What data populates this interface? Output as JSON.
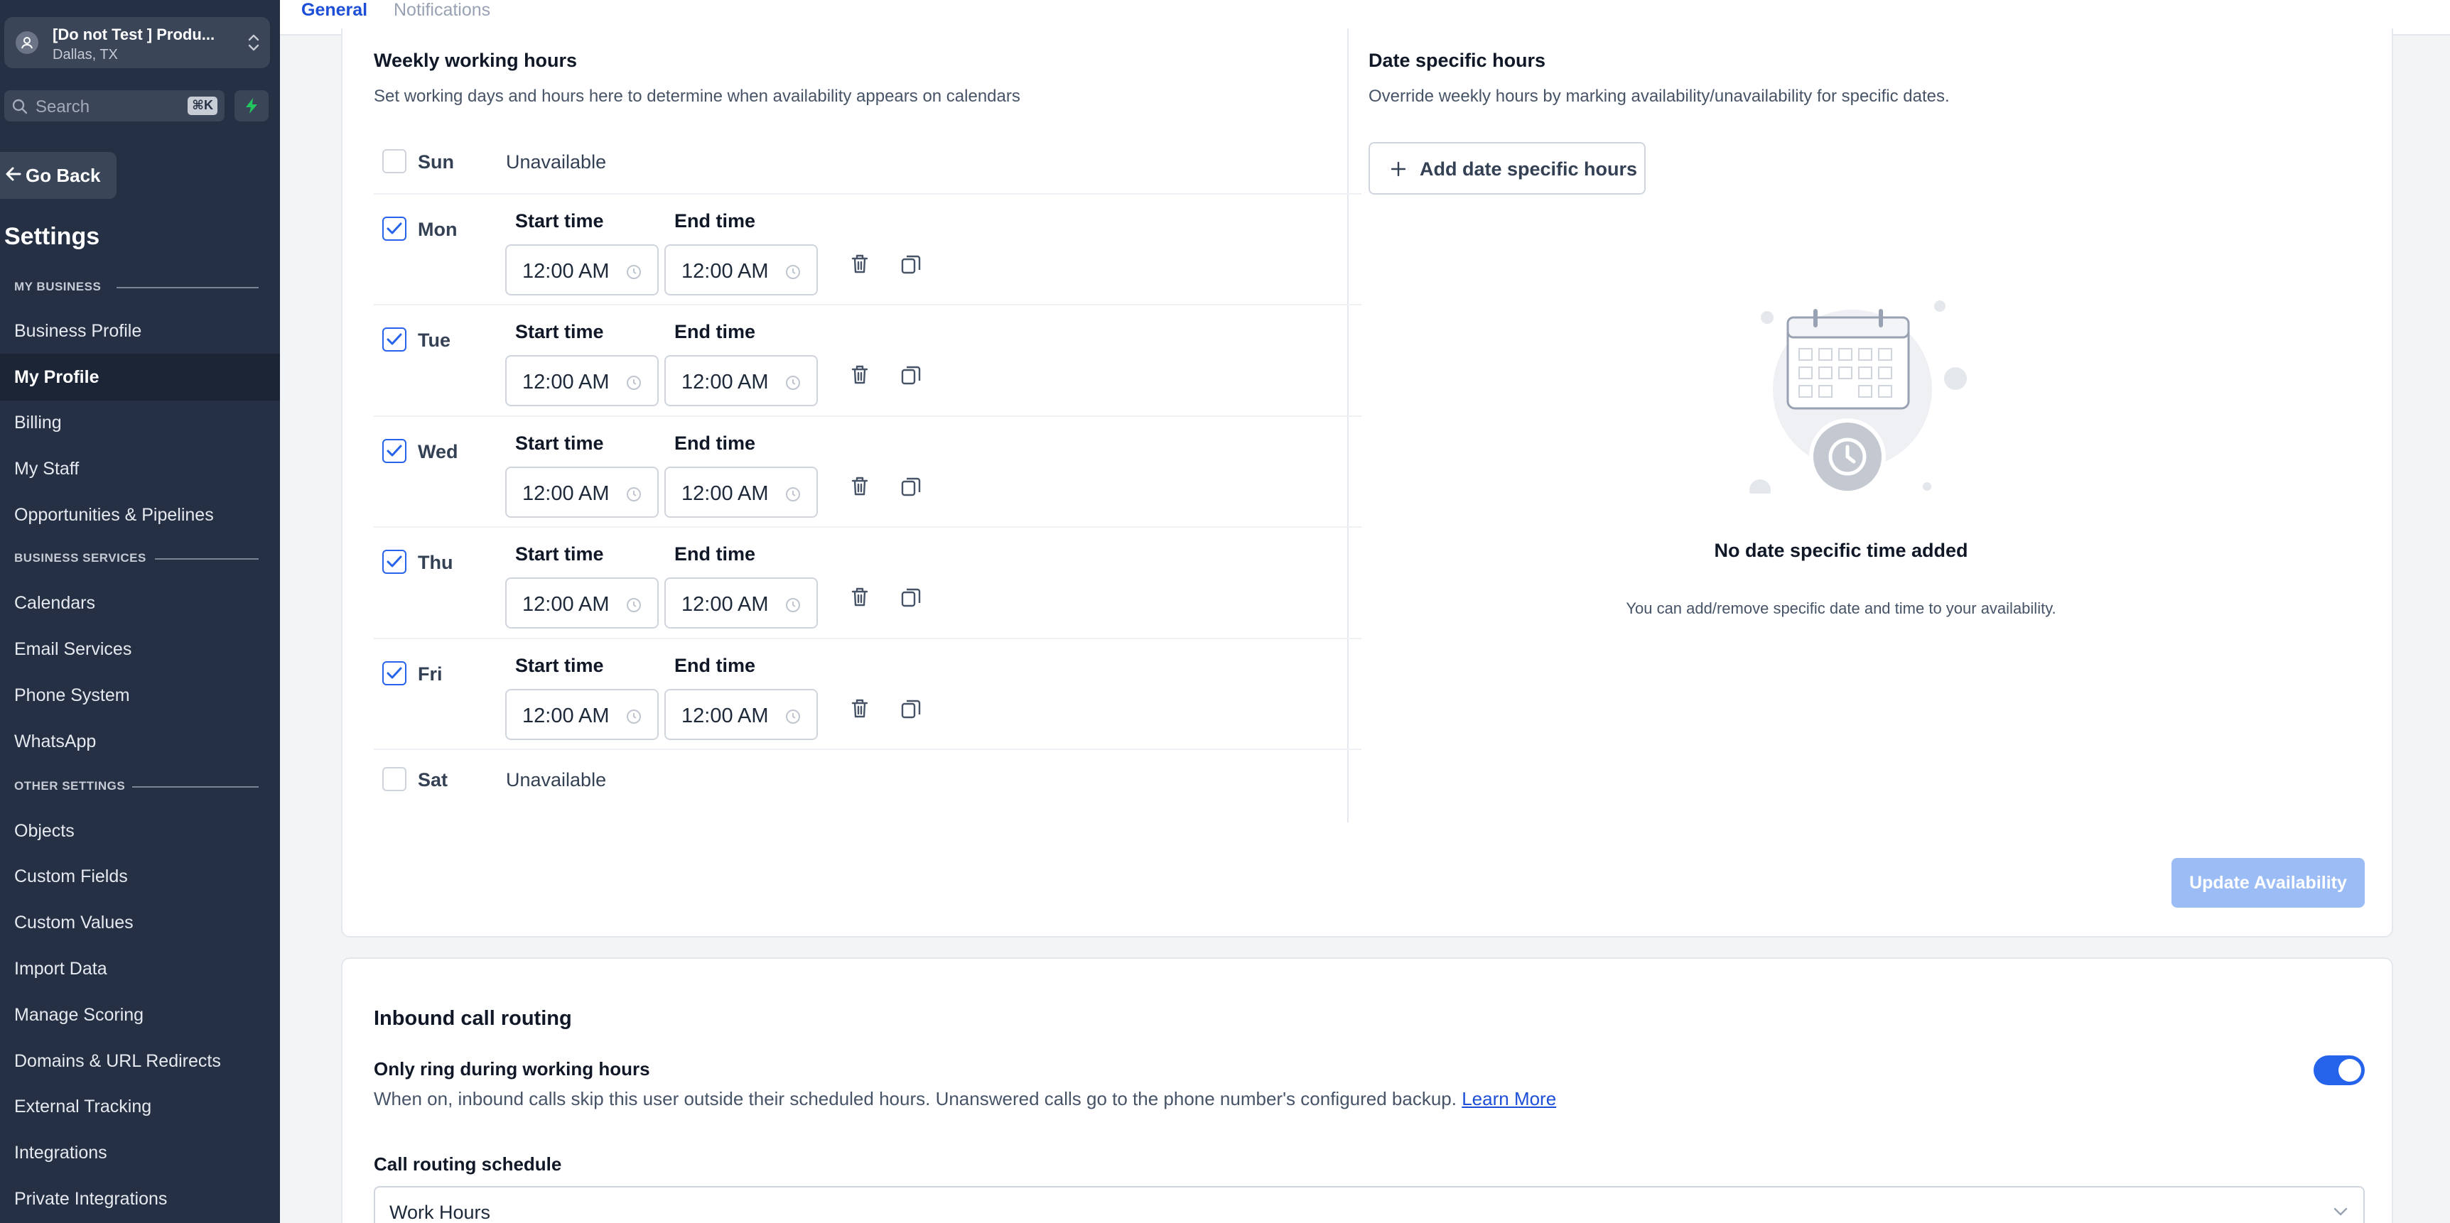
{
  "sidebar": {
    "account": {
      "name": "[Do not Test ] Produ...",
      "location": "Dallas, TX"
    },
    "search": {
      "placeholder": "Search",
      "shortcut": "⌘K"
    },
    "go_back": "Go Back",
    "title": "Settings",
    "sections": [
      {
        "heading": "MY BUSINESS",
        "items": [
          "Business Profile",
          "My Profile",
          "Billing",
          "My Staff",
          "Opportunities & Pipelines"
        ]
      },
      {
        "heading": "BUSINESS SERVICES",
        "items": [
          "Calendars",
          "Email Services",
          "Phone System",
          "WhatsApp"
        ]
      },
      {
        "heading": "OTHER SETTINGS",
        "items": [
          "Objects",
          "Custom Fields",
          "Custom Values",
          "Import Data",
          "Manage Scoring",
          "Domains & URL Redirects",
          "External Tracking",
          "Integrations",
          "Private Integrations"
        ]
      }
    ],
    "active_item": "My Profile"
  },
  "tabs": {
    "general": "General",
    "notifications": "Notifications",
    "active": "General"
  },
  "weekly": {
    "title": "Weekly working hours",
    "subtitle": "Set working days and hours here to determine when availability appears on calendars",
    "start_label": "Start time",
    "end_label": "End time",
    "unavailable_label": "Unavailable",
    "days": [
      {
        "name": "Sun",
        "enabled": false
      },
      {
        "name": "Mon",
        "enabled": true,
        "start": "12:00 AM",
        "end": "12:00 AM"
      },
      {
        "name": "Tue",
        "enabled": true,
        "start": "12:00 AM",
        "end": "12:00 AM"
      },
      {
        "name": "Wed",
        "enabled": true,
        "start": "12:00 AM",
        "end": "12:00 AM"
      },
      {
        "name": "Thu",
        "enabled": true,
        "start": "12:00 AM",
        "end": "12:00 AM"
      },
      {
        "name": "Fri",
        "enabled": true,
        "start": "12:00 AM",
        "end": "12:00 AM"
      },
      {
        "name": "Sat",
        "enabled": false
      }
    ]
  },
  "date_specific": {
    "title": "Date specific hours",
    "subtitle": "Override weekly hours by marking availability/unavailability for specific dates.",
    "add_button": "Add date specific hours",
    "empty_title": "No date specific time added",
    "empty_subtitle": "You can add/remove specific date and time to your availability."
  },
  "update_button": "Update Availability",
  "inbound": {
    "title": "Inbound call routing",
    "toggle_title": "Only ring during working hours",
    "toggle_desc": "When on, inbound calls skip this user outside their scheduled hours. Unanswered calls go to the phone number's configured backup.",
    "learn_more": "Learn More",
    "toggle_on": true,
    "schedule_label": "Call routing schedule",
    "schedule_value": "Work Hours"
  },
  "colors": {
    "sidebar_bg": "#253044",
    "accent": "#2563eb",
    "update_btn_disabled": "#9bbcf5"
  }
}
